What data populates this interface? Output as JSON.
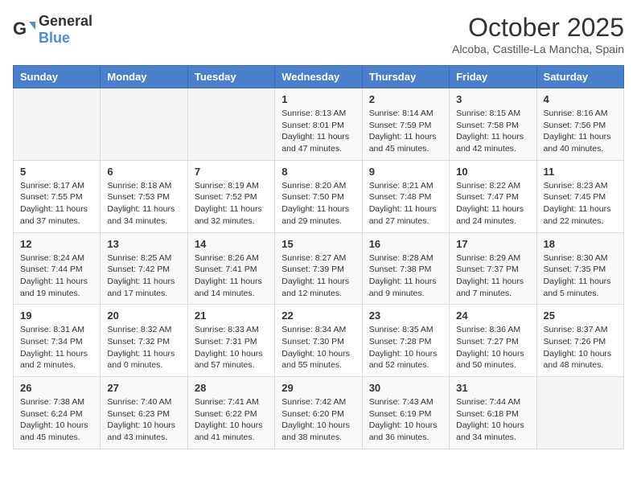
{
  "logo": {
    "general": "General",
    "blue": "Blue"
  },
  "title": "October 2025",
  "location": "Alcoba, Castille-La Mancha, Spain",
  "headers": [
    "Sunday",
    "Monday",
    "Tuesday",
    "Wednesday",
    "Thursday",
    "Friday",
    "Saturday"
  ],
  "weeks": [
    [
      {
        "day": "",
        "info": ""
      },
      {
        "day": "",
        "info": ""
      },
      {
        "day": "",
        "info": ""
      },
      {
        "day": "1",
        "info": "Sunrise: 8:13 AM\nSunset: 8:01 PM\nDaylight: 11 hours and 47 minutes."
      },
      {
        "day": "2",
        "info": "Sunrise: 8:14 AM\nSunset: 7:59 PM\nDaylight: 11 hours and 45 minutes."
      },
      {
        "day": "3",
        "info": "Sunrise: 8:15 AM\nSunset: 7:58 PM\nDaylight: 11 hours and 42 minutes."
      },
      {
        "day": "4",
        "info": "Sunrise: 8:16 AM\nSunset: 7:56 PM\nDaylight: 11 hours and 40 minutes."
      }
    ],
    [
      {
        "day": "5",
        "info": "Sunrise: 8:17 AM\nSunset: 7:55 PM\nDaylight: 11 hours and 37 minutes."
      },
      {
        "day": "6",
        "info": "Sunrise: 8:18 AM\nSunset: 7:53 PM\nDaylight: 11 hours and 34 minutes."
      },
      {
        "day": "7",
        "info": "Sunrise: 8:19 AM\nSunset: 7:52 PM\nDaylight: 11 hours and 32 minutes."
      },
      {
        "day": "8",
        "info": "Sunrise: 8:20 AM\nSunset: 7:50 PM\nDaylight: 11 hours and 29 minutes."
      },
      {
        "day": "9",
        "info": "Sunrise: 8:21 AM\nSunset: 7:48 PM\nDaylight: 11 hours and 27 minutes."
      },
      {
        "day": "10",
        "info": "Sunrise: 8:22 AM\nSunset: 7:47 PM\nDaylight: 11 hours and 24 minutes."
      },
      {
        "day": "11",
        "info": "Sunrise: 8:23 AM\nSunset: 7:45 PM\nDaylight: 11 hours and 22 minutes."
      }
    ],
    [
      {
        "day": "12",
        "info": "Sunrise: 8:24 AM\nSunset: 7:44 PM\nDaylight: 11 hours and 19 minutes."
      },
      {
        "day": "13",
        "info": "Sunrise: 8:25 AM\nSunset: 7:42 PM\nDaylight: 11 hours and 17 minutes."
      },
      {
        "day": "14",
        "info": "Sunrise: 8:26 AM\nSunset: 7:41 PM\nDaylight: 11 hours and 14 minutes."
      },
      {
        "day": "15",
        "info": "Sunrise: 8:27 AM\nSunset: 7:39 PM\nDaylight: 11 hours and 12 minutes."
      },
      {
        "day": "16",
        "info": "Sunrise: 8:28 AM\nSunset: 7:38 PM\nDaylight: 11 hours and 9 minutes."
      },
      {
        "day": "17",
        "info": "Sunrise: 8:29 AM\nSunset: 7:37 PM\nDaylight: 11 hours and 7 minutes."
      },
      {
        "day": "18",
        "info": "Sunrise: 8:30 AM\nSunset: 7:35 PM\nDaylight: 11 hours and 5 minutes."
      }
    ],
    [
      {
        "day": "19",
        "info": "Sunrise: 8:31 AM\nSunset: 7:34 PM\nDaylight: 11 hours and 2 minutes."
      },
      {
        "day": "20",
        "info": "Sunrise: 8:32 AM\nSunset: 7:32 PM\nDaylight: 11 hours and 0 minutes."
      },
      {
        "day": "21",
        "info": "Sunrise: 8:33 AM\nSunset: 7:31 PM\nDaylight: 10 hours and 57 minutes."
      },
      {
        "day": "22",
        "info": "Sunrise: 8:34 AM\nSunset: 7:30 PM\nDaylight: 10 hours and 55 minutes."
      },
      {
        "day": "23",
        "info": "Sunrise: 8:35 AM\nSunset: 7:28 PM\nDaylight: 10 hours and 52 minutes."
      },
      {
        "day": "24",
        "info": "Sunrise: 8:36 AM\nSunset: 7:27 PM\nDaylight: 10 hours and 50 minutes."
      },
      {
        "day": "25",
        "info": "Sunrise: 8:37 AM\nSunset: 7:26 PM\nDaylight: 10 hours and 48 minutes."
      }
    ],
    [
      {
        "day": "26",
        "info": "Sunrise: 7:38 AM\nSunset: 6:24 PM\nDaylight: 10 hours and 45 minutes."
      },
      {
        "day": "27",
        "info": "Sunrise: 7:40 AM\nSunset: 6:23 PM\nDaylight: 10 hours and 43 minutes."
      },
      {
        "day": "28",
        "info": "Sunrise: 7:41 AM\nSunset: 6:22 PM\nDaylight: 10 hours and 41 minutes."
      },
      {
        "day": "29",
        "info": "Sunrise: 7:42 AM\nSunset: 6:20 PM\nDaylight: 10 hours and 38 minutes."
      },
      {
        "day": "30",
        "info": "Sunrise: 7:43 AM\nSunset: 6:19 PM\nDaylight: 10 hours and 36 minutes."
      },
      {
        "day": "31",
        "info": "Sunrise: 7:44 AM\nSunset: 6:18 PM\nDaylight: 10 hours and 34 minutes."
      },
      {
        "day": "",
        "info": ""
      }
    ]
  ]
}
